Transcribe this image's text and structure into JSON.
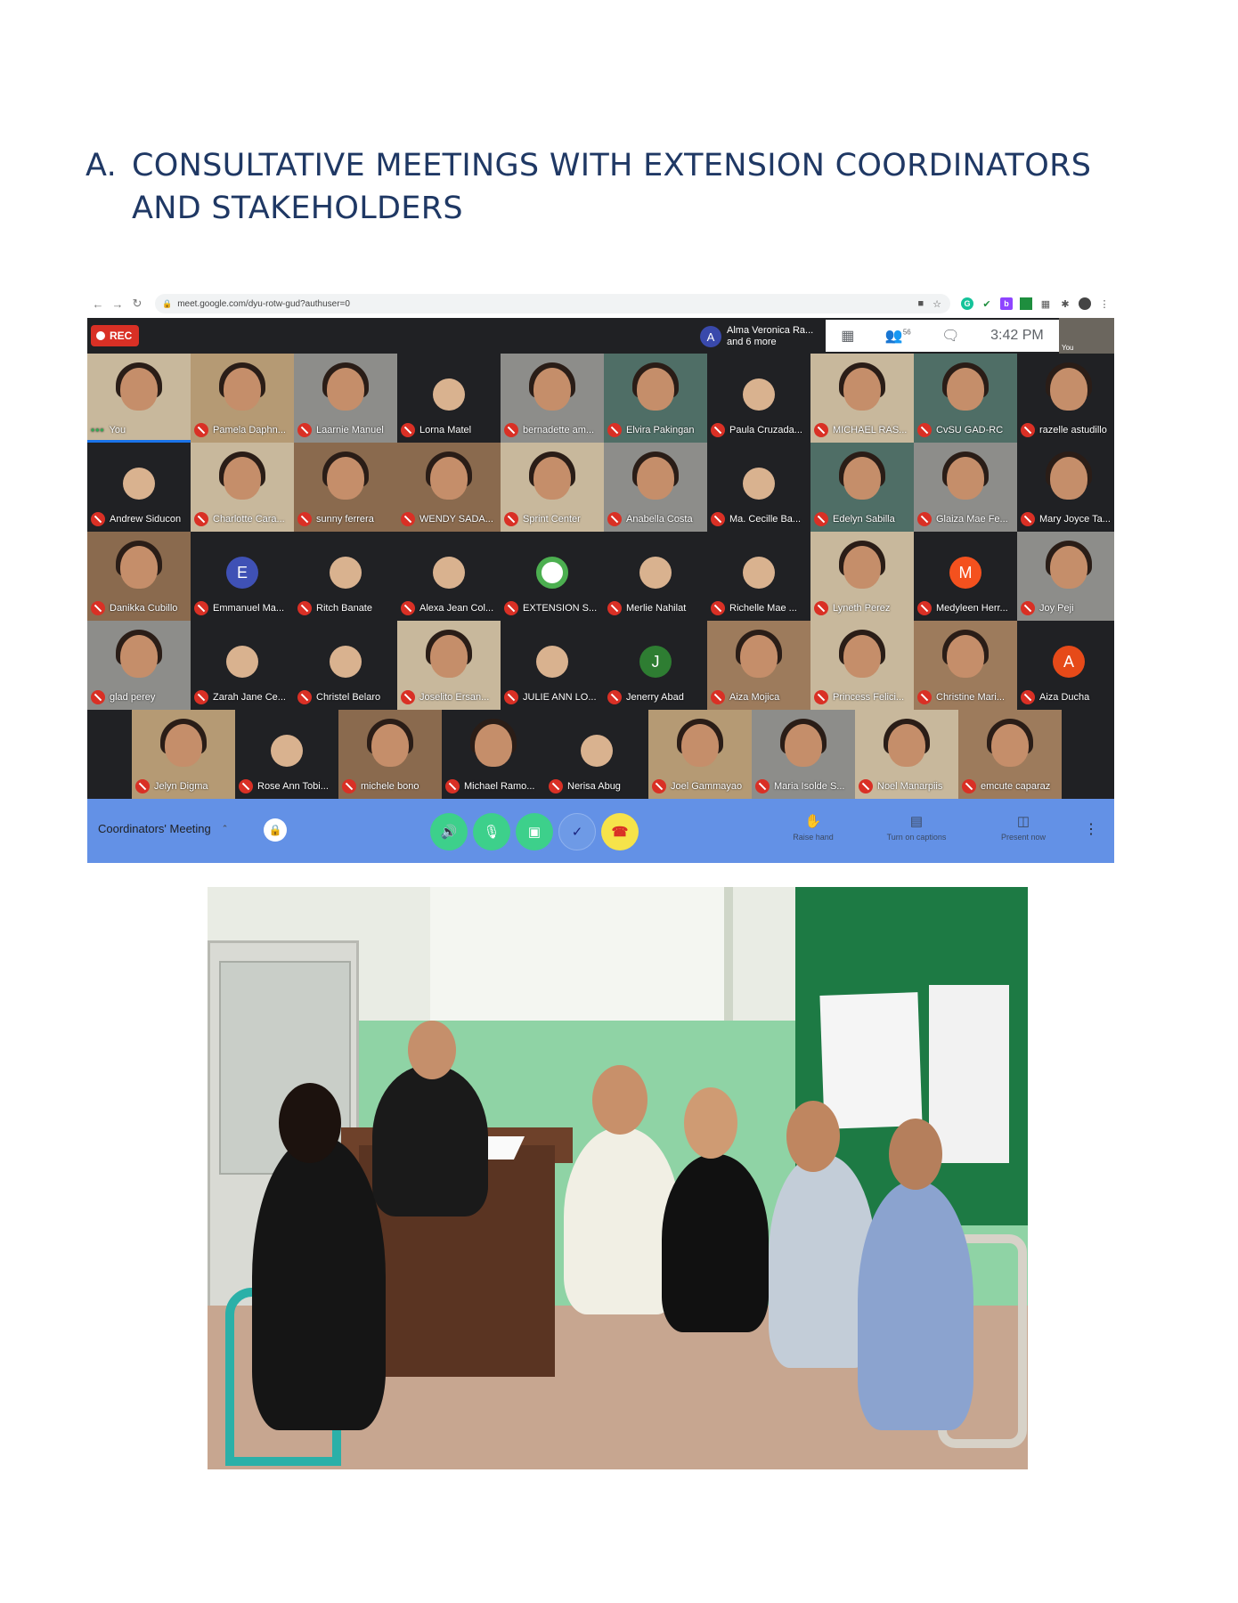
{
  "heading": {
    "letter": "A.",
    "line1": "CONSULTATIVE MEETINGS WITH EXTENSION COORDINATORS",
    "line2": "AND STAKEHOLDERS"
  },
  "browser": {
    "url": "meet.google.com/dyu-rotw-gud?authuser=0"
  },
  "meet": {
    "rec_label": "REC",
    "presenting_initial": "A",
    "presenting_name": "Alma Veronica Ra...",
    "presenting_more": "and 6 more",
    "participant_count": "56",
    "time": "3:42 PM",
    "self_label": "You",
    "meeting_title": "Coordinators' Meeting",
    "tools": {
      "raise_hand": "Raise hand",
      "captions": "Turn on captions",
      "present": "Present now"
    },
    "rows": [
      [
        {
          "name": "You",
          "style": "beige",
          "self": true
        },
        {
          "name": "Pamela Daphn...",
          "style": "shelf"
        },
        {
          "name": "Laarnie Manuel",
          "style": "gray"
        },
        {
          "name": "Lorna Matel",
          "style": "dark",
          "avatar": "photo"
        },
        {
          "name": "bernadette am...",
          "style": "gray"
        },
        {
          "name": "Elvira Pakingan",
          "style": "green"
        },
        {
          "name": "Paula Cruzada...",
          "style": "dark",
          "avatar": "photo"
        },
        {
          "name": "MICHAEL RAS...",
          "style": "beige"
        },
        {
          "name": "CvSU GAD-RC",
          "style": "green"
        },
        {
          "name": "razelle astudillo",
          "style": "dark"
        }
      ],
      [
        {
          "name": "Andrew Siducon",
          "style": "dark",
          "avatar": "photo"
        },
        {
          "name": "Charlotte Cara...",
          "style": "beige"
        },
        {
          "name": "sunny ferrera",
          "style": "brown"
        },
        {
          "name": "WENDY SADA...",
          "style": "brown"
        },
        {
          "name": "Sprint Center",
          "style": "beige"
        },
        {
          "name": "Anabella Costa",
          "style": "gray"
        },
        {
          "name": "Ma. Cecille Ba...",
          "style": "dark",
          "avatar": "photo"
        },
        {
          "name": "Edelyn Sabilla",
          "style": "green"
        },
        {
          "name": "Glaiza Mae Fe...",
          "style": "gray"
        },
        {
          "name": "Mary Joyce Ta...",
          "style": "dark"
        }
      ],
      [
        {
          "name": "Danikka Cubillo",
          "style": "brown"
        },
        {
          "name": "Emmanuel Ma...",
          "style": "dark",
          "avatar": "letter",
          "initial": "E",
          "color": "#3f51b5"
        },
        {
          "name": "Ritch Banate",
          "style": "dark",
          "avatar": "photo"
        },
        {
          "name": "Alexa Jean Col...",
          "style": "dark",
          "avatar": "photo"
        },
        {
          "name": "EXTENSION S...",
          "style": "dark",
          "avatar": "logo"
        },
        {
          "name": "Merlie Nahilat",
          "style": "dark",
          "avatar": "photo"
        },
        {
          "name": "Richelle Mae ...",
          "style": "dark",
          "avatar": "photo"
        },
        {
          "name": "Lyneth Perez",
          "style": "beige"
        },
        {
          "name": "Medyleen Herr...",
          "style": "dark",
          "avatar": "letter",
          "initial": "M",
          "color": "#f4511e"
        },
        {
          "name": "Joy Peji",
          "style": "gray"
        }
      ],
      [
        {
          "name": "glad perey",
          "style": "gray"
        },
        {
          "name": "Zarah Jane Ce...",
          "style": "dark",
          "avatar": "photo"
        },
        {
          "name": "Christel Belaro",
          "style": "dark",
          "avatar": "photo"
        },
        {
          "name": "Joselito Ersan...",
          "style": "beige"
        },
        {
          "name": "JULIE ANN LO...",
          "style": "dark",
          "avatar": "photo"
        },
        {
          "name": "Jenerry Abad",
          "style": "dark",
          "avatar": "letter",
          "initial": "J",
          "color": "#2e7d32"
        },
        {
          "name": "Aiza Mojica",
          "style": "tan"
        },
        {
          "name": "Princess Felici...",
          "style": "beige"
        },
        {
          "name": "Christine Mari...",
          "style": "tan"
        },
        {
          "name": "Aiza Ducha",
          "style": "dark",
          "avatar": "letter",
          "initial": "A",
          "color": "#e64a19"
        }
      ],
      [
        {
          "name": "Jelyn Digma",
          "style": "shelf"
        },
        {
          "name": "Rose Ann Tobi...",
          "style": "dark",
          "avatar": "photo"
        },
        {
          "name": "michele bono",
          "style": "brown"
        },
        {
          "name": "Michael Ramo...",
          "style": "dark"
        },
        {
          "name": "Nerisa Abug",
          "style": "dark",
          "avatar": "photo"
        },
        {
          "name": "Joel Gammayao",
          "style": "shelf"
        },
        {
          "name": "Maria Isolde S...",
          "style": "gray"
        },
        {
          "name": "Noel Manarpiis",
          "style": "beige"
        },
        {
          "name": "emcute caparaz",
          "style": "tan"
        }
      ]
    ]
  }
}
